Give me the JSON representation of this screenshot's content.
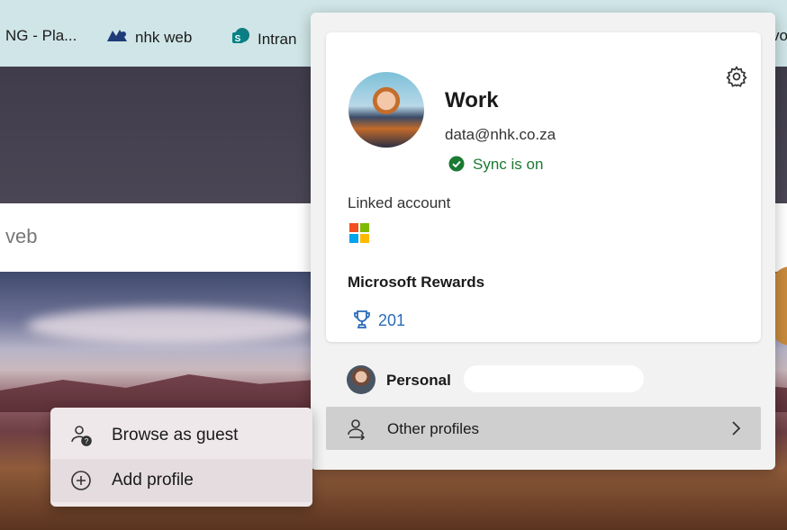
{
  "favorites": [
    {
      "label": "NG - Pla...",
      "icon": "bookmark-icon"
    },
    {
      "label": "nhk web",
      "icon": "nhk-logo-icon"
    },
    {
      "label": "Intran",
      "icon": "sharepoint-icon"
    },
    {
      "label": "vo",
      "icon": ""
    }
  ],
  "page": {
    "search_text": "veb"
  },
  "profile": {
    "name": "Work",
    "email": "data@nhk.co.za",
    "sync_status": "Sync is on",
    "linked_account_label": "Linked account",
    "rewards_label": "Microsoft Rewards",
    "rewards_points": "201"
  },
  "other": {
    "personal_label": "Personal",
    "other_profiles_label": "Other profiles"
  },
  "submenu": {
    "browse_guest": "Browse as guest",
    "add_profile": "Add profile"
  },
  "colors": {
    "sync_green": "#1a7a31",
    "rewards_blue": "#2a6bb8",
    "favbar_bg": "#cfe5e7"
  }
}
